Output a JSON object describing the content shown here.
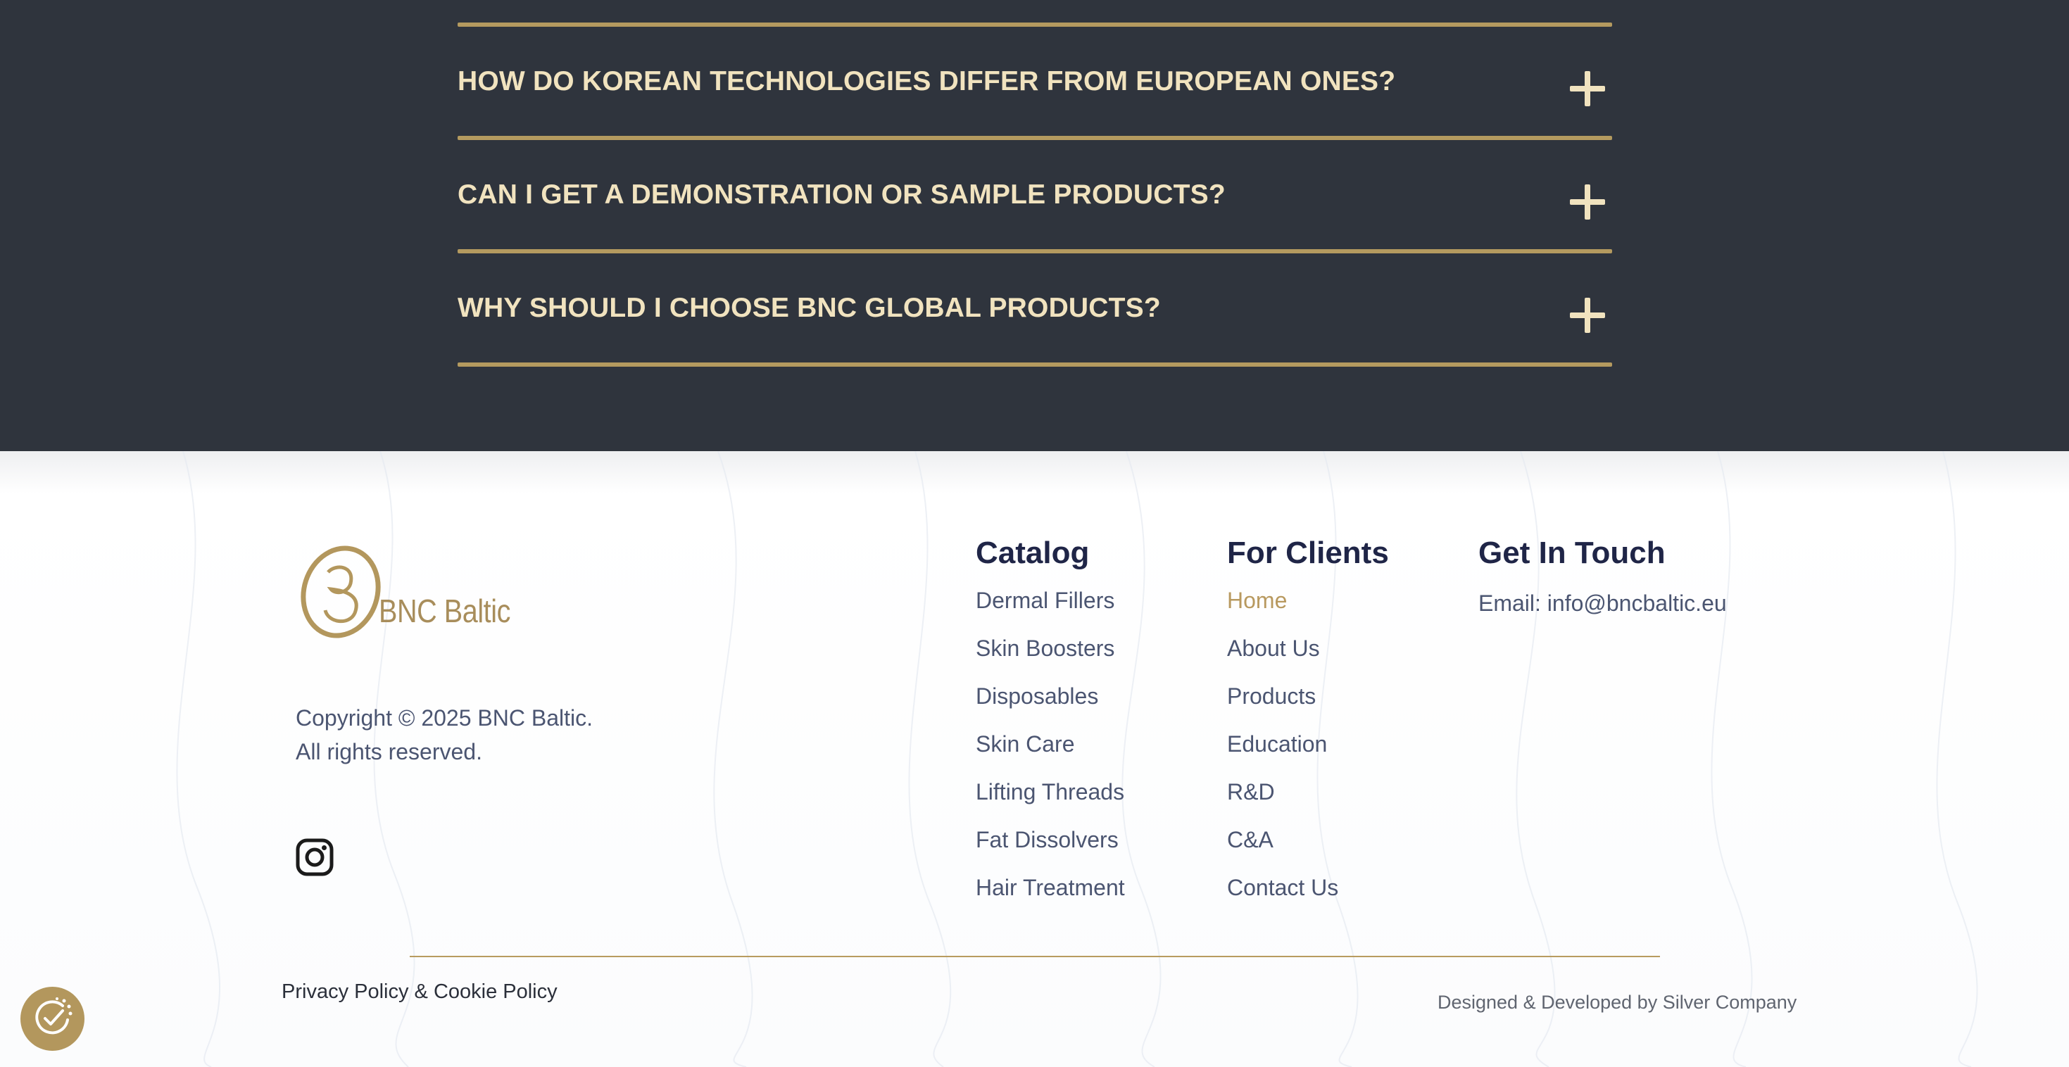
{
  "colors": {
    "faq_background": "#2f343d",
    "faq_text": "#f1e3bf",
    "accent_gold": "#b49a5f",
    "footer_heading": "#1f2547",
    "footer_text": "#4b5571",
    "active_link": "#b8995f"
  },
  "faq": {
    "items": [
      {
        "question": "HOW DO KOREAN TECHNOLOGIES DIFFER FROM EUROPEAN ONES?",
        "icon": "plus-icon"
      },
      {
        "question": "CAN I GET A DEMONSTRATION OR SAMPLE PRODUCTS?",
        "icon": "plus-icon"
      },
      {
        "question": "WHY SHOULD I CHOOSE BNC GLOBAL PRODUCTS?",
        "icon": "plus-icon"
      }
    ]
  },
  "footer": {
    "logo": {
      "brand": "BNC Baltic",
      "icon": "bnc-logo-icon"
    },
    "copyright_line1": "Copyright © 2025 BNC Baltic.",
    "copyright_line2": "All rights reserved.",
    "social": {
      "icon": "instagram-icon"
    },
    "catalog": {
      "title": "Catalog",
      "links": [
        "Dermal Fillers",
        "Skin Boosters",
        "Disposables",
        "Skin Care",
        "Lifting Threads",
        "Fat Dissolvers",
        "Hair Treatment"
      ]
    },
    "clients": {
      "title": "For Clients",
      "links": [
        "Home",
        "About Us",
        "Products",
        "Education",
        "R&D",
        "C&A",
        "Contact Us"
      ],
      "active": "Home"
    },
    "touch": {
      "title": "Get In Touch",
      "email": "Email: info@bncbaltic.eu"
    },
    "policy": "Privacy Policy & Cookie Policy",
    "credits": "Designed & Developed by Silver Company"
  },
  "cookie_badge": {
    "icon": "cookie-consent-icon"
  }
}
